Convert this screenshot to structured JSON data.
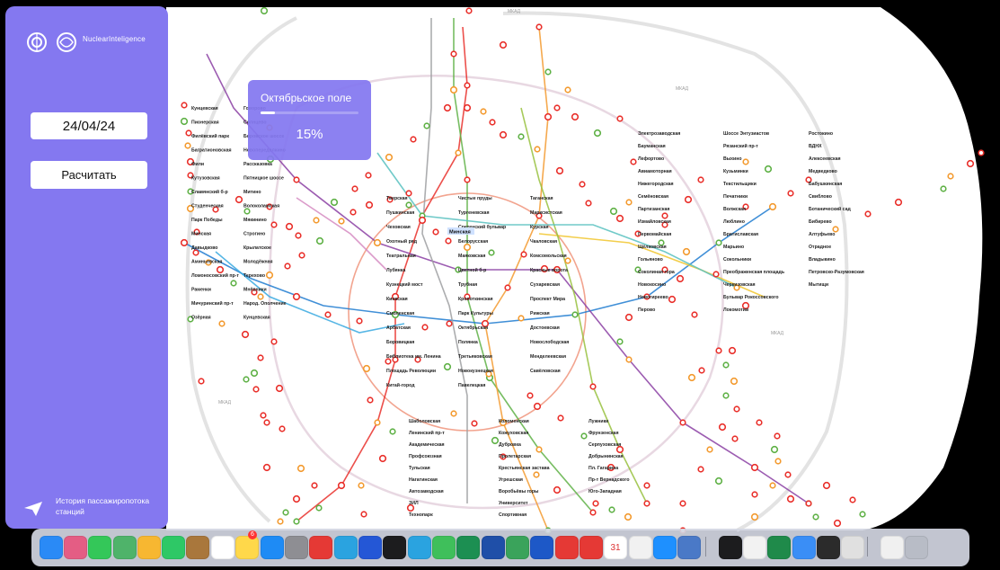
{
  "sidebar": {
    "logo_text": "NuclearInteligence",
    "date": "24/04/24",
    "calculate_label": "Расчитать",
    "history_label": "История пассажиропотока станций"
  },
  "popup": {
    "station": "Октябрьское поле",
    "percent_text": "15%",
    "percent_value": 15
  },
  "map": {
    "background_color": "#ffffff",
    "ring_color": "#f2a48f",
    "circle_line_color": "#c3a6e8",
    "highlighted_station": "Минская",
    "line_labels": [
      "МКАД",
      "МКАД",
      "МКАД",
      "МКАД",
      "МКАД"
    ],
    "stations_left": [
      "Кунцевская",
      "Пионерская",
      "Филёвский парк",
      "Багратионовская",
      "Фили",
      "Кутузовская",
      "Славянский б-р",
      "Студенческая",
      "Парк Победы",
      "Минская",
      "Давыдково",
      "Аминьевская",
      "Ломоносовский пр-т",
      "Раменки",
      "Мичуринский пр-т",
      "Озёрная",
      "Говорово",
      "Солнцево",
      "Боровское шоссе",
      "Новопеределкино",
      "Рассказовка",
      "Пятницкое шоссе",
      "Митино",
      "Волоколамская",
      "Мякинино",
      "Строгино",
      "Крылатское",
      "Молодёжная",
      "Терехово",
      "Мнёвники",
      "Народ. Ополчение",
      "Кунцевская"
    ],
    "stations_center": [
      "Тверская",
      "Пушкинская",
      "Чеховская",
      "Охотный ряд",
      "Театральная",
      "Лубянка",
      "Кузнецкий мост",
      "Киевская",
      "Смоленская",
      "Арбатская",
      "Боровицкая",
      "Библиотека им. Ленина",
      "Площадь Революции",
      "Китай-город",
      "Чистые пруды",
      "Тургеневская",
      "Сретенский бульвар",
      "Белорусская",
      "Маяковская",
      "Цветной б-р",
      "Трубная",
      "Кропоткинская",
      "Парк Культуры",
      "Октябрьская",
      "Полянка",
      "Третьяковская",
      "Новокузнецкая",
      "Павелецкая",
      "Таганская",
      "Марксистская",
      "Курская",
      "Чкаловская",
      "Комсомольская",
      "Красные ворота",
      "Сухаревская",
      "Проспект Мира",
      "Рижская",
      "Достоевская",
      "Новослободская",
      "Менделеевская",
      "Савёловская"
    ],
    "stations_right": [
      "Электрозаводская",
      "Бауманская",
      "Лефортово",
      "Авиамоторная",
      "Нижегородская",
      "Семёновская",
      "Партизанская",
      "Измайловская",
      "Первомайская",
      "Щёлковская",
      "Гольяново",
      "Соколиная гора",
      "Новокосино",
      "Новогиреево",
      "Перово",
      "Шоссе Энтузиастов",
      "Рязанский пр-т",
      "Выхино",
      "Кузьминки",
      "Текстильщики",
      "Печатники",
      "Волжская",
      "Люблино",
      "Братиславская",
      "Марьино",
      "Сокольники",
      "Преображенская площадь",
      "Черкизовская",
      "Бульвар Рокоссовского",
      "Локомотив",
      "Ростокино",
      "ВДНХ",
      "Алексеевская",
      "Медведково",
      "Бабушкинская",
      "Свиблово",
      "Ботанический сад",
      "Бибирево",
      "Алтуфьево",
      "Отрадное",
      "Владыкино",
      "Петровско-Разумовская",
      "Мытищи"
    ],
    "stations_south": [
      "Шаболовская",
      "Ленинский пр-т",
      "Академическая",
      "Профсоюзная",
      "Тульская",
      "Нагатинская",
      "Автозаводская",
      "ЗИЛ",
      "Технопарк",
      "Коломенская",
      "Кожуховская",
      "Дубровка",
      "Пролетарская",
      "Крестьянская застава",
      "Угрешская",
      "Воробьёвы горы",
      "Университет",
      "Спортивная",
      "Лужники",
      "Фрунзенская",
      "Серпуховская",
      "Добрынинская",
      "Пл. Гагарина",
      "Пр-т Вернадского",
      "Юго-Западная"
    ]
  },
  "dock": {
    "items": [
      {
        "icon": "finder-icon",
        "color": "#2a8af6"
      },
      {
        "icon": "launchpad-icon",
        "color": "#e45d84"
      },
      {
        "icon": "messages-icon",
        "color": "#34c759"
      },
      {
        "icon": "maps-icon",
        "color": "#4fb36a"
      },
      {
        "icon": "photos-icon",
        "color": "#f7b731"
      },
      {
        "icon": "facetime-icon",
        "color": "#2ec866"
      },
      {
        "icon": "notes-brown-icon",
        "color": "#a9773c"
      },
      {
        "icon": "reminders-icon",
        "color": "#ffffff"
      },
      {
        "icon": "notes-icon",
        "color": "#ffd84a"
      },
      {
        "icon": "app-store-icon",
        "color": "#1e8bf5"
      },
      {
        "icon": "system-settings-icon",
        "color": "#8e8e93"
      },
      {
        "icon": "flow-icon",
        "color": "#e53935"
      },
      {
        "icon": "telegram-icon",
        "color": "#2aa3e0"
      },
      {
        "icon": "stealth-icon",
        "color": "#2457d6"
      },
      {
        "icon": "clock-icon",
        "color": "#1c1c1e"
      },
      {
        "icon": "telegram-alt-icon",
        "color": "#2aa3e0"
      },
      {
        "icon": "keystroke-icon",
        "color": "#3fbf5b"
      },
      {
        "icon": "graph-icon",
        "color": "#1c8f52"
      },
      {
        "icon": "paypal-icon",
        "color": "#1f4fa8"
      },
      {
        "icon": "vpn-icon",
        "color": "#3aa35b"
      },
      {
        "icon": "bitwarden-icon",
        "color": "#1d58c7"
      },
      {
        "icon": "vmware-icon",
        "color": "#e53935"
      },
      {
        "icon": "opera-icon",
        "color": "#e53935"
      },
      {
        "icon": "calendar-icon",
        "color": "#ffffff"
      },
      {
        "icon": "freeform-icon",
        "color": "#f1f1f1"
      },
      {
        "icon": "safari-icon",
        "color": "#1e90ff"
      },
      {
        "icon": "preview-icon",
        "color": "#4a79c7"
      },
      {
        "icon": "github-icon",
        "color": "#1c1c1e"
      },
      {
        "icon": "chrome-icon",
        "color": "#f2f2f2"
      },
      {
        "icon": "excel-icon",
        "color": "#1f8a4a"
      },
      {
        "icon": "xcode-icon",
        "color": "#3a8ef6"
      },
      {
        "icon": "datagrip-icon",
        "color": "#2b2b2b"
      },
      {
        "icon": "font-book-icon",
        "color": "#e0e0e0"
      },
      {
        "icon": "disk-utility-icon",
        "color": "#f0f0f0"
      },
      {
        "icon": "trash-icon",
        "color": "#b8bcc6"
      }
    ],
    "calendar_day": "31",
    "reminders_badge": "6"
  }
}
